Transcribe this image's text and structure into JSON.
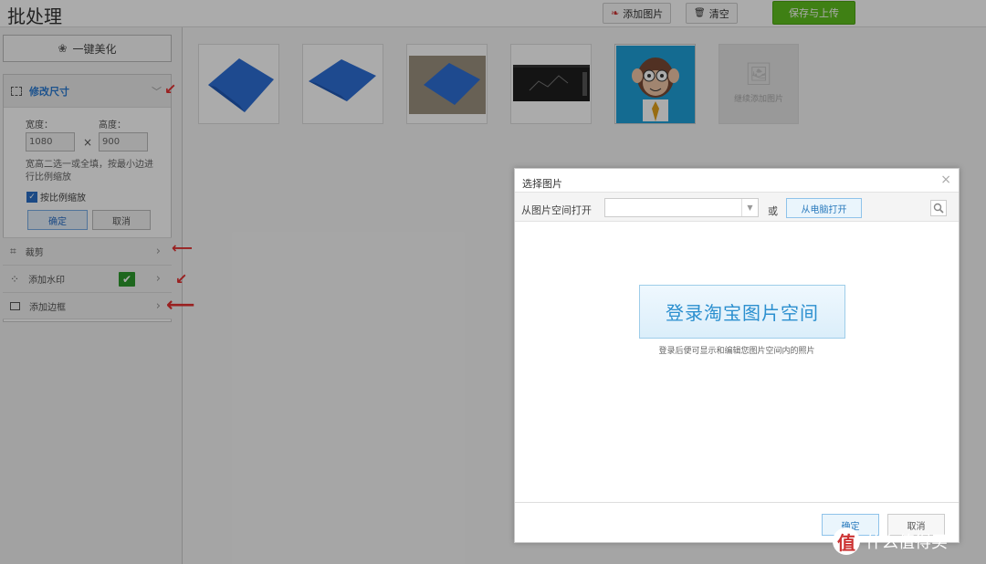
{
  "app": {
    "title": "批处理"
  },
  "toolbar": {
    "add_image_label": "添加图片",
    "clear_label": "清空",
    "save_upload_label": "保存与上传"
  },
  "sidebar": {
    "beautify_label": "一键美化",
    "resize": {
      "title": "修改尺寸",
      "width_label": "宽度：",
      "height_label": "高度：",
      "width_value": "1080",
      "height_value": "900",
      "times": "×",
      "hint": "宽高二选一或全填，按最小边进行比例缩放",
      "keep_ratio_label": "按比例缩放",
      "keep_ratio_checked": true,
      "ok_label": "确定",
      "cancel_label": "取消"
    },
    "items": [
      {
        "label": "裁剪"
      },
      {
        "label": "添加水印"
      },
      {
        "label": "添加边框"
      }
    ]
  },
  "gallery": {
    "add_more_label": "继续添加图片"
  },
  "dialog": {
    "title": "选择图片",
    "open_from_label": "从图片空间打开",
    "or_label": "或",
    "open_pc_label": "从电脑打开",
    "login_label": "登录淘宝图片空间",
    "login_hint": "登录后便可显示和编辑您图片空间内的照片",
    "ok_label": "确定",
    "cancel_label": "取消"
  },
  "watermark": {
    "logo_text": "值",
    "text": "什么值得买"
  },
  "colors": {
    "accent_blue": "#2b7bd3",
    "save_green": "#5fbf1f",
    "arrow_red": "#e53030"
  }
}
